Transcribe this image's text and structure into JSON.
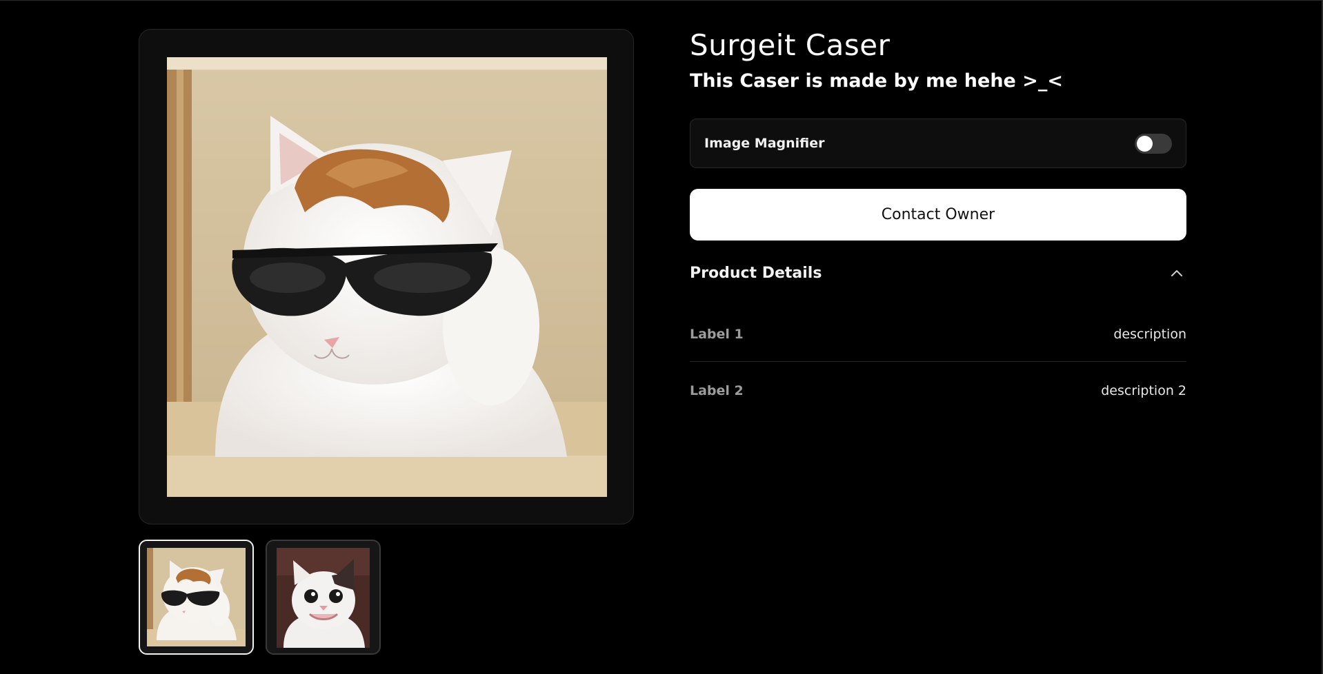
{
  "product": {
    "title": "Surgeit Caser",
    "subtitle": "This Caser is made by me hehe >_<"
  },
  "gallery": {
    "main_image": "cat-with-sunglasses-image",
    "thumbnails": [
      {
        "image": "cat-with-sunglasses-thumbnail",
        "selected": true
      },
      {
        "image": "smiling-cat-thumbnail",
        "selected": false
      }
    ]
  },
  "magnifier": {
    "label": "Image Magnifier",
    "enabled": false
  },
  "actions": {
    "contact_label": "Contact Owner"
  },
  "details": {
    "title": "Product Details",
    "expanded": true,
    "toggle_icon": "chevron-up-icon",
    "rows": [
      {
        "label": "Label 1",
        "value": "description"
      },
      {
        "label": "Label 2",
        "value": "description 2"
      }
    ]
  },
  "colors": {
    "background": "#000000",
    "card": "#0e0e0e",
    "button_bg": "#ffffff",
    "button_text": "#111111",
    "muted_label": "#9c9c9c"
  }
}
